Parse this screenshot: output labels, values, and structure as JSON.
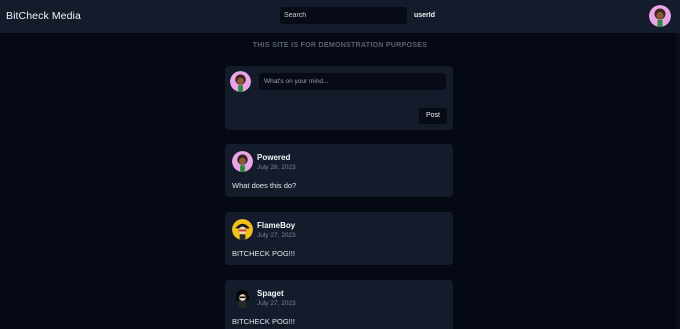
{
  "header": {
    "brand": "BitCheck Media",
    "search_placeholder": "Search",
    "user_id": "userId"
  },
  "disclaimer": "THIS SITE IS FOR DEMONSTRATION PURPOSES",
  "composer": {
    "placeholder": "What's on your mind...",
    "post_label": "Post"
  },
  "posts": [
    {
      "author": "Powered",
      "date": "July 28, 2023",
      "body": "What does this do?",
      "avatar": "pink-cartoon-avatar"
    },
    {
      "author": "FlameBoy",
      "date": "July 27, 2023",
      "body": "BITCHECK POG!!!",
      "avatar": "yellow-cartoon-avatar"
    },
    {
      "author": "Spaget",
      "date": "July 27, 2023",
      "body": "BITCHECK POG!!!",
      "avatar": "black-cartoon-avatar"
    }
  ],
  "colors": {
    "background": "#050914",
    "card": "#141b2b",
    "input": "#070b16",
    "muted_text": "#7d8496"
  }
}
